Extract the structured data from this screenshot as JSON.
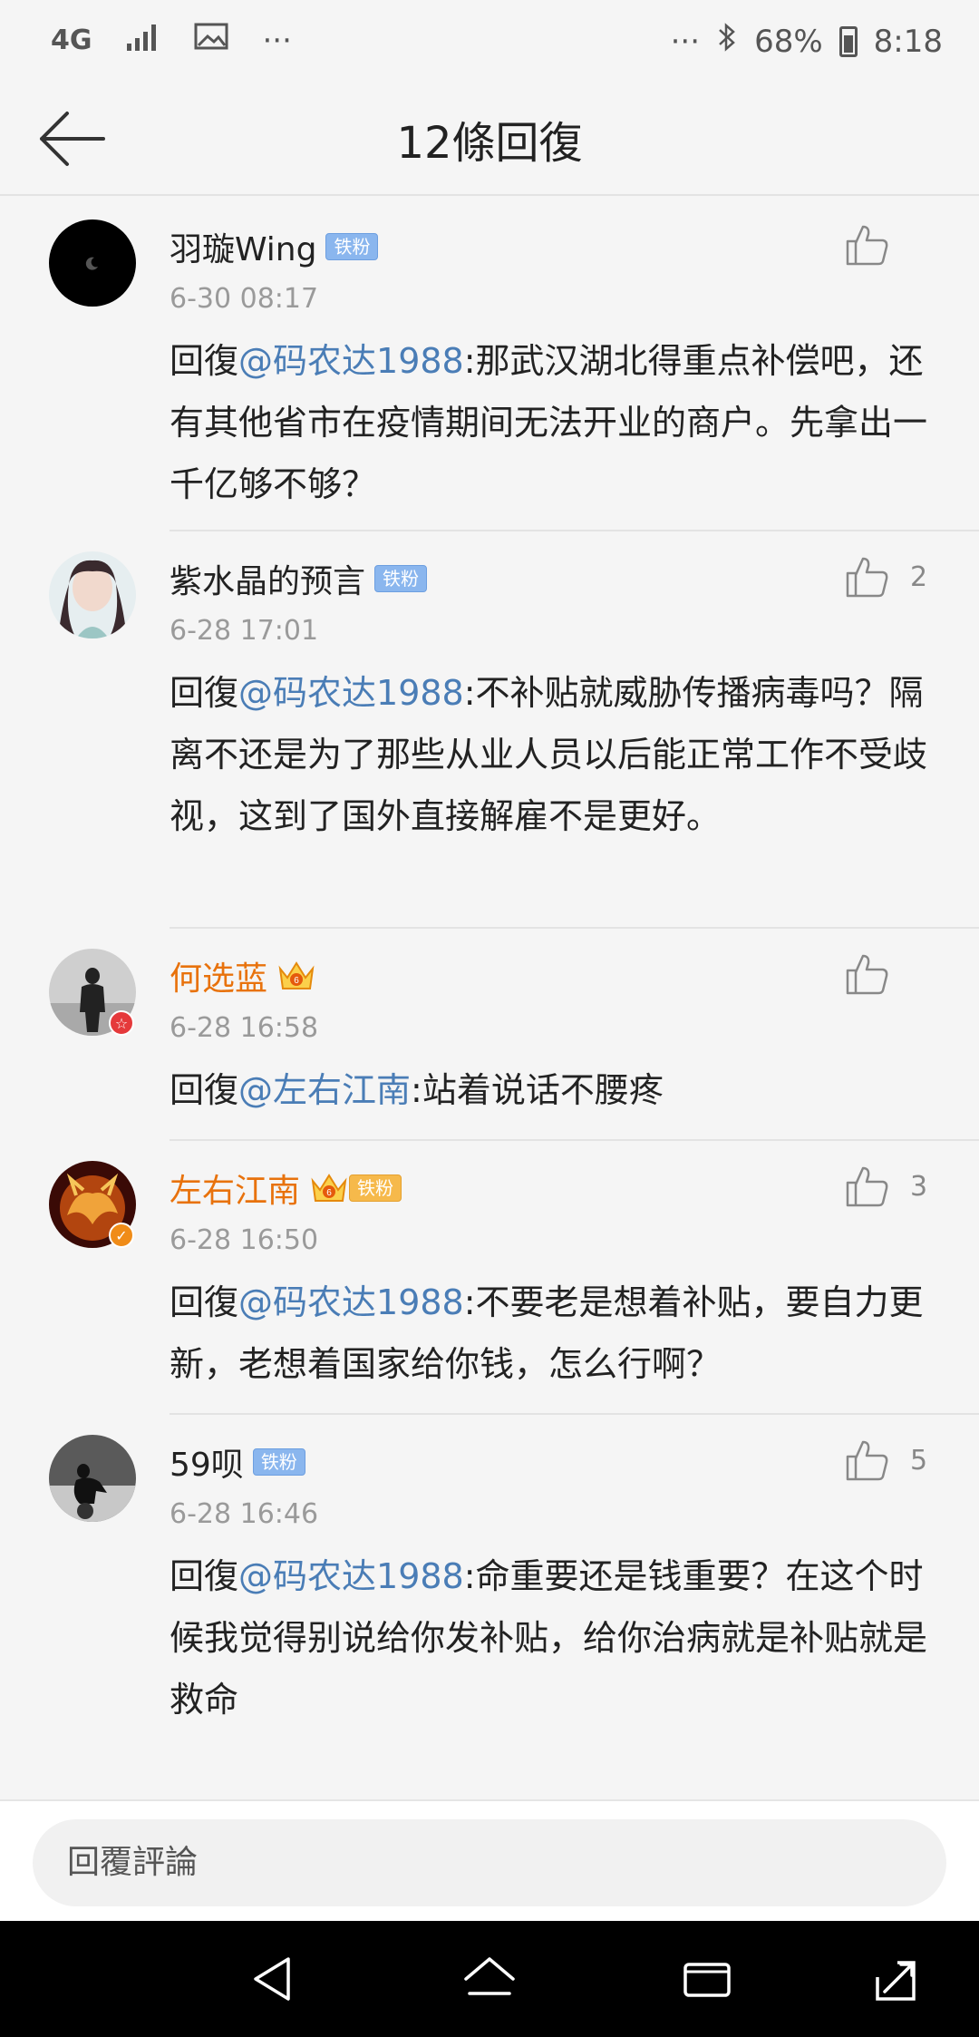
{
  "status_bar": {
    "network": "4G",
    "overflow_left": "···",
    "overflow_right": "···",
    "battery": "68%",
    "time": "8:18"
  },
  "header": {
    "title": "12條回復"
  },
  "comments": [
    {
      "name": "羽璇Wing",
      "badge": "铁粉",
      "time": "6-30 08:17",
      "reply_prefix": "回復",
      "mention": "@码农达1988",
      "text": ":那武汉湖北得重点补偿吧，还有其他省市在疫情期间无法开业的商户。先拿出一千亿够不够？",
      "likes": ""
    },
    {
      "name": "紫水晶的预言",
      "badge": "铁粉",
      "time": "6-28 17:01",
      "reply_prefix": "回復",
      "mention": "@码农达1988",
      "text": ":不补贴就威胁传播病毒吗？隔离不还是为了那些从业人员以后能正常工作不受歧视，这到了国外直接解雇不是更好。",
      "likes": "2"
    },
    {
      "name": "何选蓝",
      "badge": "",
      "crown_level": "6",
      "time": "6-28 16:58",
      "reply_prefix": "回復",
      "mention": "@左右江南",
      "text": ":站着说话不腰疼",
      "likes": ""
    },
    {
      "name": "左右江南",
      "badge": "铁粉",
      "crown_level": "6",
      "time": "6-28 16:50",
      "reply_prefix": "回復",
      "mention": "@码农达1988",
      "text": ":不要老是想着补贴，要自力更新，老想着国家给你钱，怎么行啊？",
      "likes": "3"
    },
    {
      "name": "59呗",
      "badge": "铁粉",
      "time": "6-28 16:46",
      "reply_prefix": "回復",
      "mention": "@码农达1988",
      "text": ":命重要还是钱重要？在这个时候我觉得别说给你发补贴，给你治病就是补贴就是救命",
      "likes": "5"
    }
  ],
  "reply_bar": {
    "placeholder": "回覆評論"
  },
  "colors": {
    "mention": "#4a7db6",
    "vip_name": "#e8720c",
    "badge": "#8ab6ee"
  }
}
